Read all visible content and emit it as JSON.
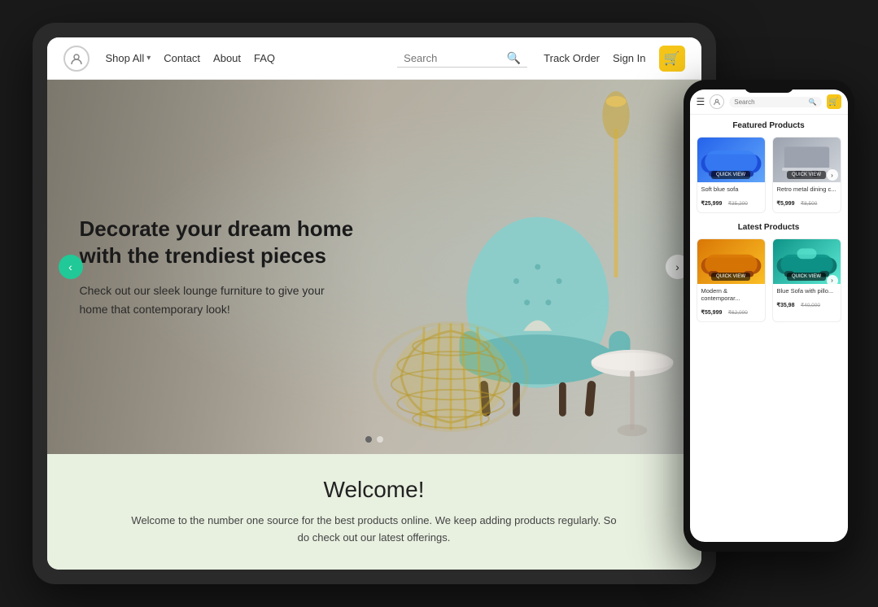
{
  "tablet": {
    "navbar": {
      "logo_alt": "Logo",
      "links": [
        {
          "label": "Shop All",
          "has_dropdown": true
        },
        {
          "label": "Contact"
        },
        {
          "label": "About"
        },
        {
          "label": "FAQ"
        }
      ],
      "search_placeholder": "Search",
      "track_order": "Track Order",
      "sign_in": "Sign In"
    },
    "hero": {
      "title": "Decorate your dream home with the trendiest pieces",
      "subtitle": "Check out our sleek lounge furniture to give your home that contemporary look!",
      "prev_label": "‹",
      "next_label": "›",
      "dots": [
        {
          "active": true
        },
        {
          "active": false
        }
      ]
    },
    "welcome": {
      "title": "Welcome!",
      "text": "Welcome to the number one source for the best products online. We keep adding products regularly. So do check out our latest offerings."
    }
  },
  "phone": {
    "navbar": {
      "menu_icon": "☰",
      "search_placeholder": "Search",
      "cart_icon": "🛒"
    },
    "featured_section": {
      "title": "Featured Products",
      "products": [
        {
          "name": "Soft blue sofa",
          "price": "₹25,999",
          "old_price": "₹35,200",
          "img_class": "phone-product-img-blue"
        },
        {
          "name": "Retro metal dining c...",
          "price": "₹5,999",
          "old_price": "₹8,500",
          "img_class": "phone-product-img-gray"
        }
      ]
    },
    "latest_section": {
      "title": "Latest Products",
      "products": [
        {
          "name": "Modern & contemporar...",
          "price": "₹55,999",
          "old_price": "₹62,000",
          "img_class": "phone-product-img-modern"
        },
        {
          "name": "Blue Sofa with pillo...",
          "price": "₹35,98",
          "old_price": "₹40,000",
          "img_class": "phone-product-img-teal"
        }
      ]
    },
    "quick_view_label": "QUICK VIEW"
  }
}
